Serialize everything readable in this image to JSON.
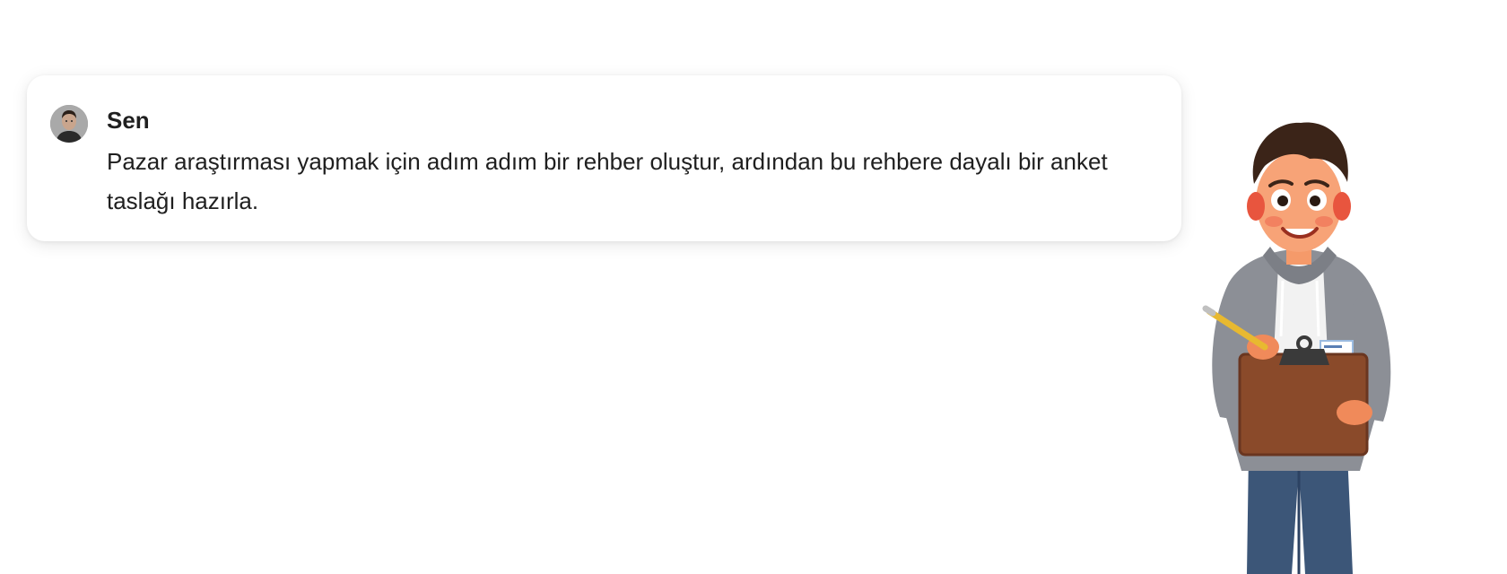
{
  "message": {
    "sender": "Sen",
    "text": "Pazar araştırması yapmak için adım adım bir rehber oluştur, ardından bu rehbere dayalı bir anket taslağı hazırla."
  },
  "icons": {
    "avatar": "user-avatar",
    "character": "cartoon-surveyor-with-clipboard"
  },
  "colors": {
    "card_background": "#ffffff",
    "text": "#1f1f1f",
    "hoodie": "#8c8f96",
    "clipboard": "#8a4a2a",
    "jeans": "#3c5678"
  }
}
